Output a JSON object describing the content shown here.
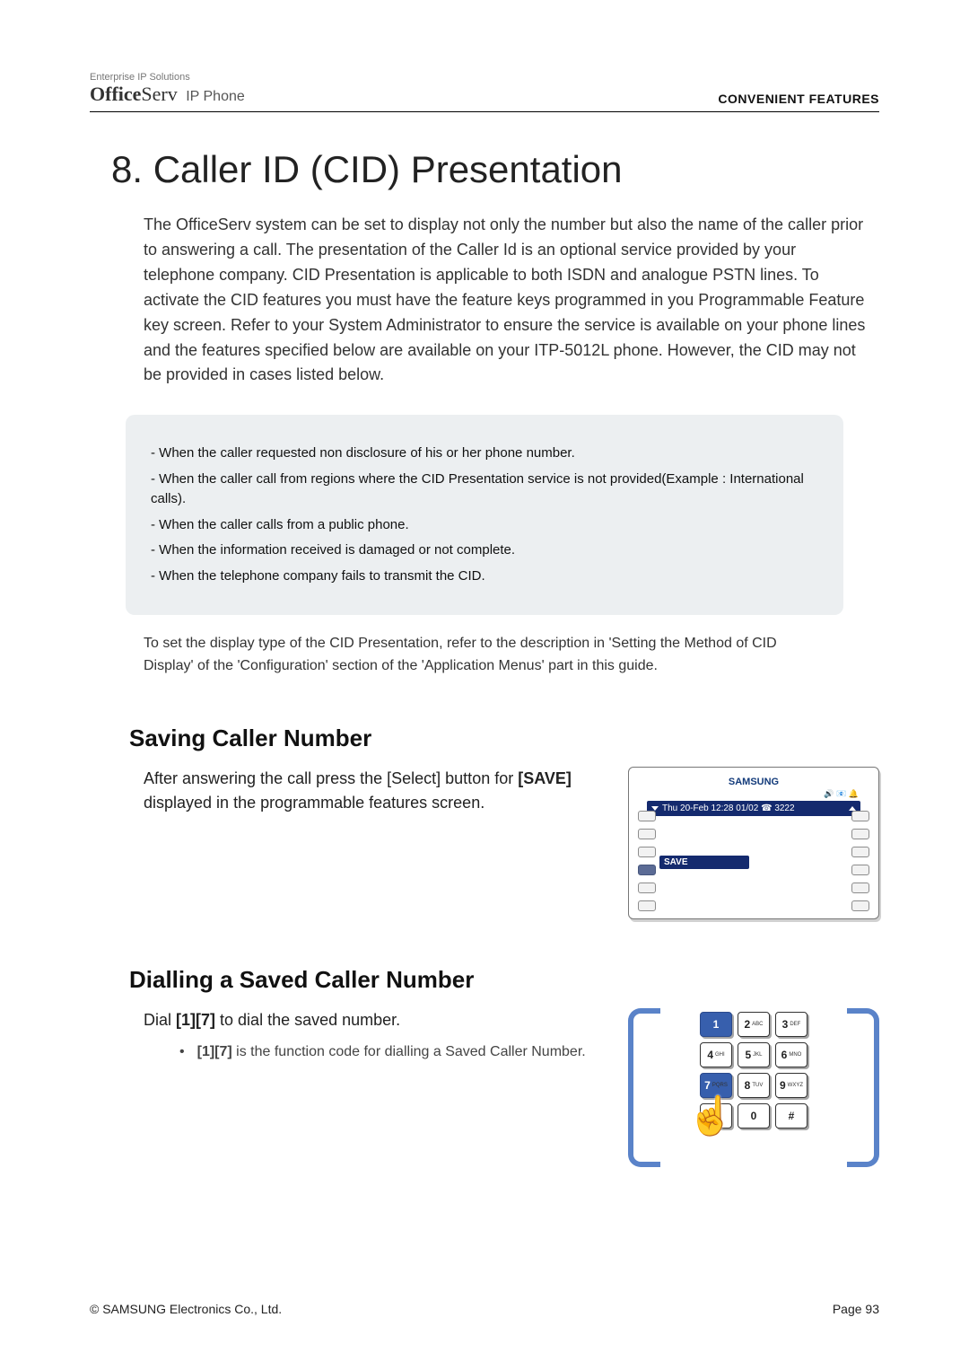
{
  "header": {
    "brand_tagline": "Enterprise IP Solutions",
    "brand_bold": "Office",
    "brand_rest": "Serv",
    "brand_sub": "IP Phone",
    "section_label": "CONVENIENT FEATURES"
  },
  "title": "8. Caller ID (CID) Presentation",
  "intro": "The OfficeServ system can be set to display not only the number but also the name of the caller prior to answering a call. The presentation of the Caller Id is an optional service provided by your telephone company. CID Presentation is applicable to both ISDN and analogue PSTN lines. To activate the CID features you must have the feature keys programmed in you Programmable Feature key screen. Refer to your System Administrator to ensure the service is available on your phone lines and the features specified below are available on your ITP-5012L phone. However, the CID may not be provided in cases listed below.",
  "callout": {
    "lines": [
      "- When the caller requested non disclosure of his or her phone number.",
      "- When the caller call from regions where the CID Presentation service is not provided(Example : International calls).",
      "- When the caller calls from a public phone.",
      "- When the information received is damaged or not complete.",
      "- When the telephone company fails to transmit the CID."
    ]
  },
  "note": "To set the display type of the CID Presentation, refer to the description in 'Setting the Method of CID Display' of the 'Configuration' section of the 'Application Menus' part in this guide.",
  "saving": {
    "heading": "Saving Caller Number",
    "text_pre": "After answering the call press the [Select] button for ",
    "text_bold": "[SAVE]",
    "text_post": " displayed in the programmable features screen.",
    "device": {
      "brand": "SAMSUNG",
      "icons": "🔊 📧 🔔",
      "title_bar": "Thu 20-Feb 12:28  01/02 ☎ 3222",
      "save_label": "SAVE"
    }
  },
  "dialling": {
    "heading": "Dialling a Saved Caller Number",
    "line_pre": "Dial ",
    "line_bold": "[1][7]",
    "line_post": " to dial the saved number.",
    "bullet_pre": "[1][7]",
    "bullet_post": " is the function code for dialling a Saved Caller Number.",
    "keys": [
      {
        "main": "1",
        "sub": "",
        "hl": true
      },
      {
        "main": "2",
        "sub": "ABC",
        "hl": false
      },
      {
        "main": "3",
        "sub": "DEF",
        "hl": false
      },
      {
        "main": "4",
        "sub": "GHI",
        "hl": false
      },
      {
        "main": "5",
        "sub": "JKL",
        "hl": false
      },
      {
        "main": "6",
        "sub": "MNO",
        "hl": false
      },
      {
        "main": "7",
        "sub": "PQRS",
        "hl": true
      },
      {
        "main": "8",
        "sub": "TUV",
        "hl": false
      },
      {
        "main": "9",
        "sub": "WXYZ",
        "hl": false
      },
      {
        "main": "✱",
        "sub": "",
        "hl": false
      },
      {
        "main": "0",
        "sub": "",
        "hl": false
      },
      {
        "main": "#",
        "sub": "",
        "hl": false
      }
    ]
  },
  "footer": {
    "copyright": "© SAMSUNG Electronics Co., Ltd.",
    "page": "Page 93"
  }
}
